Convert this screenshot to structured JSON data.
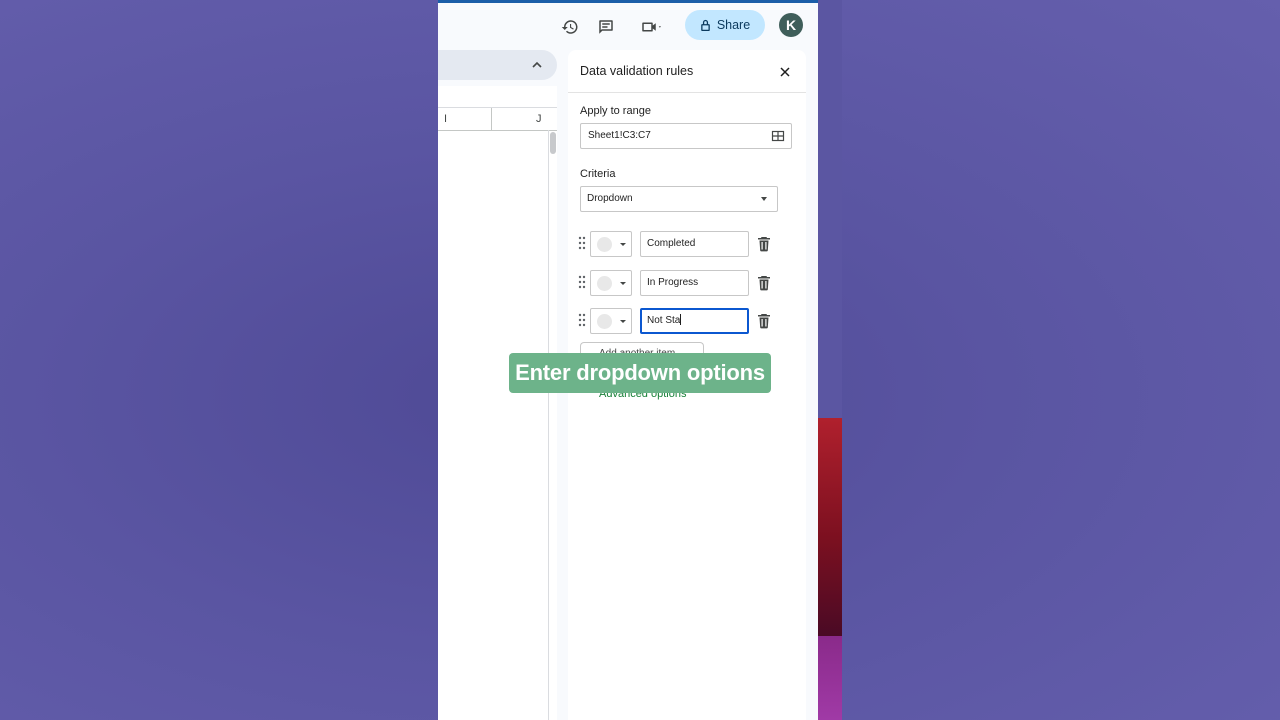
{
  "topbar": {
    "icons": [
      "history-icon",
      "comment-icon",
      "meet-icon"
    ],
    "share_label": "Share",
    "avatar_initial": "K"
  },
  "grid": {
    "column_headers": [
      "I",
      "J"
    ]
  },
  "panel": {
    "title": "Data validation rules",
    "apply_label": "Apply to range",
    "range_value": "Sheet1!C3:C7",
    "criteria_label": "Criteria",
    "criteria_value": "Dropdown",
    "options": [
      {
        "value": "Completed"
      },
      {
        "value": "In Progress"
      },
      {
        "value": "Not Sta"
      }
    ],
    "add_item_label": "Add another item",
    "advanced_label": "Advanced options"
  },
  "overlay": {
    "caption": "Enter dropdown options"
  },
  "colors": {
    "accent_blue": "#0b57d0",
    "share_bg": "#c2e7ff",
    "advanced_green": "#188038",
    "caption_bg": "#6db38a"
  }
}
